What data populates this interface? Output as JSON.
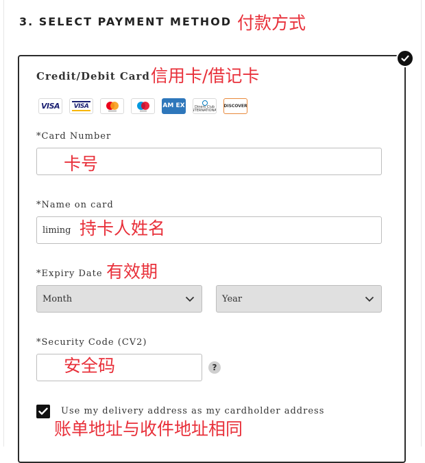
{
  "section": {
    "title": "3. SELECT PAYMENT METHOD",
    "annotation": "付款方式"
  },
  "card_panel": {
    "heading": "Credit/Debit Card",
    "heading_annotation": "信用卡/借记卡",
    "selected_icon": "check-circle-icon",
    "logos": [
      {
        "icon": "visa-logo-icon",
        "text": "VISA"
      },
      {
        "icon": "visa-electron-logo-icon",
        "text": "VISA"
      },
      {
        "icon": "mastercard-logo-icon",
        "text": ""
      },
      {
        "icon": "maestro-logo-icon",
        "text": ""
      },
      {
        "icon": "amex-logo-icon",
        "text": "AM EX"
      },
      {
        "icon": "diners-club-logo-icon",
        "text": "Diners Club INTERNATIONAL"
      },
      {
        "icon": "discover-logo-icon",
        "text": "DISCOVER"
      }
    ]
  },
  "form": {
    "card_number": {
      "label": "*Card Number",
      "value": "",
      "annotation": "卡号"
    },
    "name_on_card": {
      "label": "*Name on card",
      "value": "liming",
      "annotation": "持卡人姓名"
    },
    "expiry": {
      "label": "*Expiry Date",
      "annotation": "有效期",
      "month_value": "Month",
      "year_value": "Year"
    },
    "security_code": {
      "label": "*Security Code (CV2)",
      "value": "",
      "annotation": "安全码",
      "help_text": "?"
    },
    "same_address": {
      "checked": true,
      "label": "Use my delivery address as my cardholder address",
      "annotation": "账单地址与收件地址相同"
    }
  },
  "colors": {
    "annotation": "#e8303a",
    "border": "#2b2b2b",
    "select_bg": "#e0e0e0"
  }
}
